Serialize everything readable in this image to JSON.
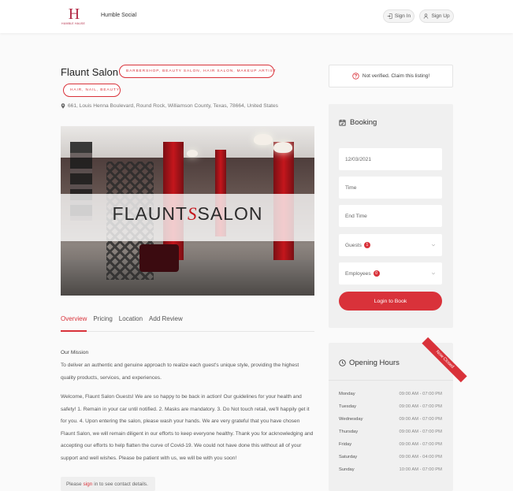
{
  "header": {
    "logo_text": "HUMBLE HAUSE",
    "brand": "Humble Social",
    "signin_label": "Sign In",
    "signup_label": "Sign Up"
  },
  "listing": {
    "title": "Flaunt Salon",
    "tags_primary": "BARBERSHOP, BEAUTY SALON, HAIR SALON, MAKEUP ARTIST",
    "tags_secondary": "HAIR, NAIL, BEAUTY",
    "address": "661, Louis Henna Boulevard, Round Rock, Williamson County, Texas, 78664, United States",
    "hero_left": "FLAUNT",
    "hero_mark": "S",
    "hero_right": "SALON"
  },
  "tabs": [
    {
      "label": "Overview",
      "active": true
    },
    {
      "label": "Pricing",
      "active": false
    },
    {
      "label": "Location",
      "active": false
    },
    {
      "label": "Add Review",
      "active": false
    }
  ],
  "description": {
    "heading": "Our Mission",
    "mission": "To deliver an authentic and genuine approach to realize each guest's unique style, providing the highest quality products, services, and experiences.",
    "body": "Welcome, Flaunt Salon Guests! We are so happy to be back in action! Our guidelines for your health and safety! 1. Remain in your car until notified. 2. Masks are mandatory. 3. Do Not touch retail, we'll happily get it for you. 4. Upon entering the salon, please wash your hands. We are very grateful that you have chosen Flaunt Salon, we will remain diligent in our efforts to keep everyone healthy. Thank you for acknowledging and accepting our efforts to help flatten the curve of Covid-19. We could not have done this without all of your support and well wishes. Please be patient with us, we will be with you soon!",
    "contact_prefix": "Please",
    "contact_link": "sign",
    "contact_suffix": "in to see contact details."
  },
  "verify": {
    "label": "Not verified. Claim this listing!"
  },
  "booking": {
    "title": "Booking",
    "date_value": "12/03/2021",
    "time_placeholder": "Time",
    "end_time_placeholder": "End Time",
    "guests_label": "Guests",
    "guests_count": "1",
    "employees_label": "Employees",
    "employees_count": "0",
    "login_button": "Login to Book"
  },
  "hours": {
    "title": "Opening Hours",
    "ribbon": "Now Closed",
    "rows": [
      {
        "day": "Monday",
        "time": "09:00 AM - 07:00 PM"
      },
      {
        "day": "Tuesday",
        "time": "09:00 AM - 07:00 PM"
      },
      {
        "day": "Wednesday",
        "time": "09:00 AM - 07:00 PM"
      },
      {
        "day": "Thursday",
        "time": "09:00 AM - 07:00 PM"
      },
      {
        "day": "Friday",
        "time": "09:00 AM - 07:00 PM"
      },
      {
        "day": "Saturday",
        "time": "09:00 AM - 04:00 PM"
      },
      {
        "day": "Sunday",
        "time": "10:00 AM - 07:00 PM"
      }
    ]
  },
  "colors": {
    "accent": "#d9323a",
    "brand": "#b22a46"
  }
}
